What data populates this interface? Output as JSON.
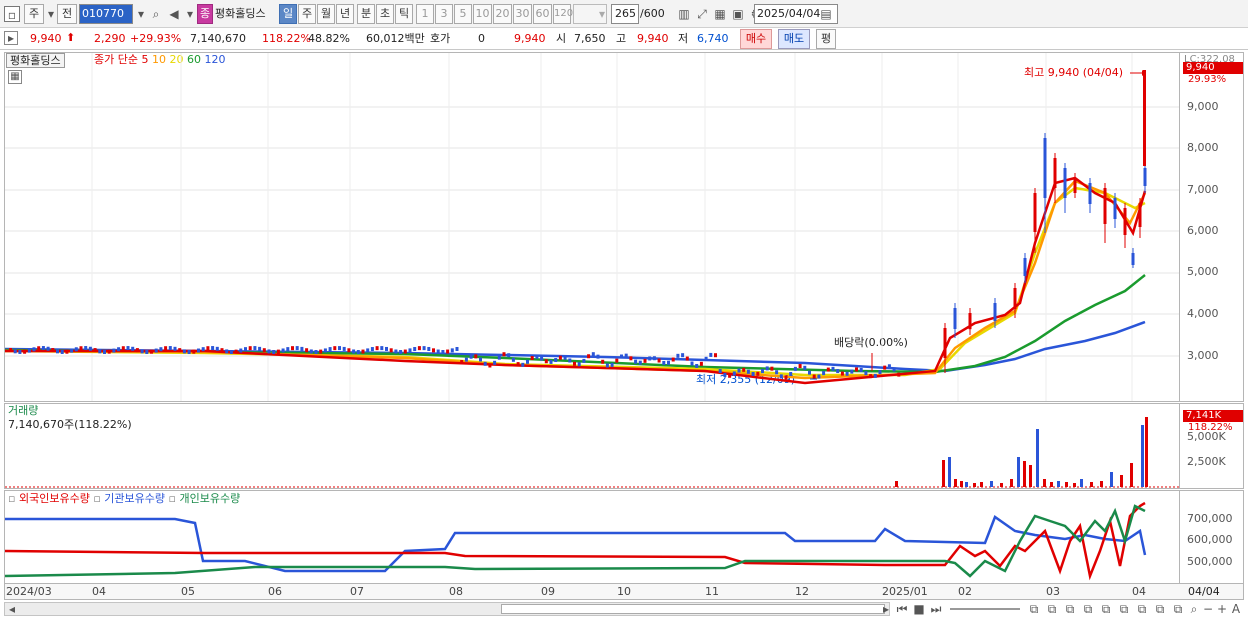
{
  "toolbar": {
    "market": "주",
    "prev": "전",
    "code": "010770",
    "name": "평화홀딩스",
    "name_prefix": "종",
    "periods": [
      "일",
      "주",
      "월",
      "년",
      "분",
      "초",
      "틱"
    ],
    "active_period": "일",
    "minutes": [
      "1",
      "3",
      "5",
      "10",
      "20",
      "30",
      "60",
      "120"
    ],
    "count": "265",
    "total": "/600",
    "date": "2025/04/04"
  },
  "quote": {
    "price": "9,940",
    "change": "2,290",
    "change_pct": "+29.93%",
    "volume": "7,140,670",
    "vol_pct": "118.22%",
    "turnover_pct": "48.82%",
    "amount": "60,012백만",
    "hoga_label": "호가",
    "hoga_val": "0",
    "hoga_price": "9,940",
    "open_label": "시",
    "open": "7,650",
    "high_label": "고",
    "high": "9,940",
    "low_label": "저",
    "low": "6,740",
    "buy": "매수",
    "sell": "매도",
    "avg": "평"
  },
  "price_panel": {
    "title": "평화홀딩스",
    "ma_label": "종가 단순",
    "ma_periods": [
      "5",
      "10",
      "20",
      "60",
      "120"
    ],
    "ma_colors": [
      "#e00000",
      "#ff9900",
      "#e8d800",
      "#1a9b2e",
      "#2a55d8"
    ],
    "high_note": "최고 9,940 (04/04)",
    "low_note": "최저 2,355 (12/09)",
    "dividend_note": "배당락(0.00%)",
    "scale_top": "LC:322.08",
    "tag_price": "9,940",
    "tag_pct": "29.93%",
    "y_ticks": [
      "9,000",
      "8,000",
      "7,000",
      "6,000",
      "5,000",
      "4,000",
      "3,000"
    ]
  },
  "volume_panel": {
    "title": "거래량",
    "value": "7,140,670주(118.22%)",
    "tag": "7,141K",
    "tag_pct": "118.22%",
    "y_ticks": [
      "5,000K",
      "2,500K"
    ]
  },
  "holding_panel": {
    "series": [
      "외국인보유수량",
      "기관보유수량",
      "개인보유수량"
    ],
    "colors": [
      "#e00000",
      "#2a55d8",
      "#1a8a4a"
    ],
    "y_ticks": [
      "700,000",
      "600,000",
      "500,000"
    ]
  },
  "x_axis": {
    "labels": [
      "2024/03",
      "04",
      "05",
      "06",
      "07",
      "08",
      "09",
      "10",
      "11",
      "12",
      "2025/01",
      "02",
      "03",
      "04"
    ],
    "right_label": "04/04"
  }
}
